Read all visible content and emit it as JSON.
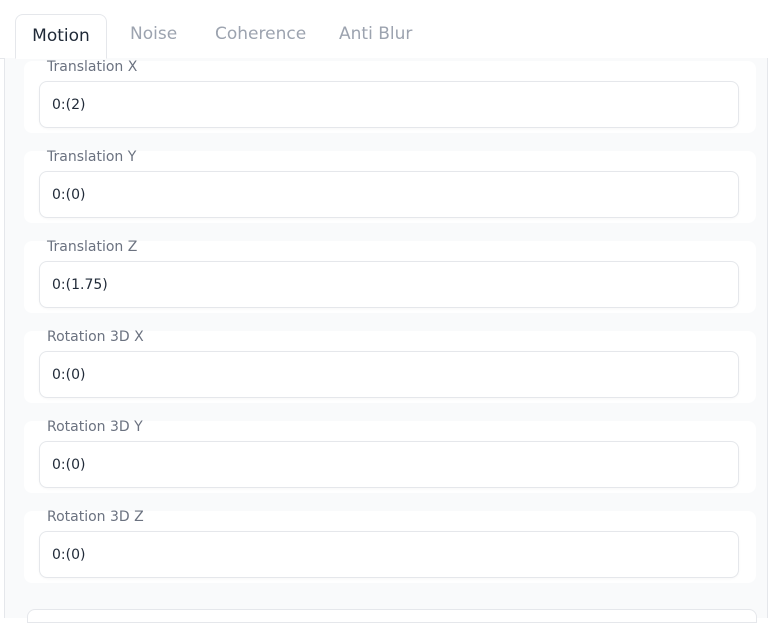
{
  "tabs": {
    "items": [
      {
        "label": "Motion"
      },
      {
        "label": "Noise"
      },
      {
        "label": "Coherence"
      },
      {
        "label": "Anti Blur"
      }
    ],
    "active": "Motion"
  },
  "fields": [
    {
      "label": "Translation X",
      "value": "0:(2)"
    },
    {
      "label": "Translation Y",
      "value": "0:(0)"
    },
    {
      "label": "Translation Z",
      "value": "0:(1.75)"
    },
    {
      "label": "Rotation 3D X",
      "value": "0:(0)"
    },
    {
      "label": "Rotation 3D Y",
      "value": "0:(0)"
    },
    {
      "label": "Rotation 3D Z",
      "value": "0:(0)"
    }
  ]
}
